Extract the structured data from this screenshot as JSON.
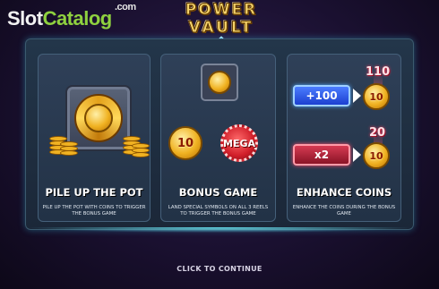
{
  "watermark": {
    "part1": "Slot",
    "part2": "Catalog",
    "suffix": ".com"
  },
  "game_logo": {
    "line1": "POWER",
    "line2": "VAULT"
  },
  "panels": [
    {
      "title": "PILE UP THE POT",
      "description": "PILE UP THE POT WITH COINS TO TRIGGER THE BONUS GAME"
    },
    {
      "title": "BONUS GAME",
      "description": "LAND SPECIAL SYMBOLS ON ALL 3 REELS TO TRIGGER THE BONUS GAME",
      "coin_value": "10",
      "mega_label": "MEGA"
    },
    {
      "title": "ENHANCE COINS",
      "description": "ENHANCE THE COINS DURING THE BONUS GAME",
      "examples": [
        {
          "modifier": "+100",
          "coin": "10",
          "result": "110"
        },
        {
          "modifier": "x2",
          "coin": "10",
          "result": "20"
        }
      ]
    }
  ],
  "continue_label": "CLICK TO CONTINUE",
  "colors": {
    "background": "#1a1030",
    "panel": "#2a3a50",
    "frame_glow": "#6ef0ff",
    "gold": "#f0b222",
    "blue_modifier": "#1c3fd0",
    "red_modifier": "#8a1426"
  }
}
